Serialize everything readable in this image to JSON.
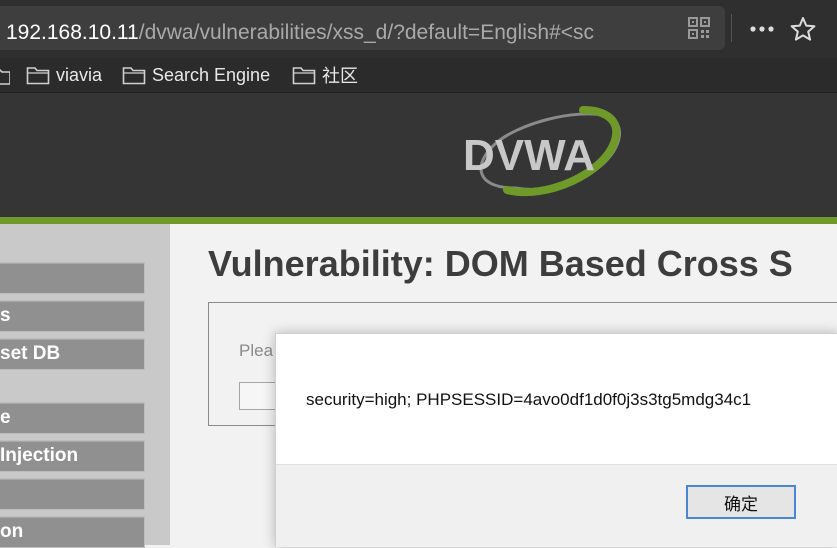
{
  "browser": {
    "url_host": "192.168.10.11",
    "url_path": "/dvwa/vulnerabilities/xss_d/?default=English#<sc",
    "bookmarks": [
      {
        "label": "viavia"
      },
      {
        "label": "Search Engine"
      },
      {
        "label": "社区"
      }
    ]
  },
  "header": {
    "logo_text": "DVWA"
  },
  "sidebar": {
    "items": [
      {
        "label": ""
      },
      {
        "label": "s"
      },
      {
        "label": "set DB"
      },
      {
        "label": "e"
      },
      {
        "label": "Injection"
      },
      {
        "label": ""
      },
      {
        "label": "on"
      }
    ]
  },
  "main": {
    "title": "Vulnerability: DOM Based Cross S",
    "form_prompt": "Plea"
  },
  "alert": {
    "message": "security=high; PHPSESSID=4avo0df1d0f0j3s3tg5mdg34c1",
    "ok_label": "确定"
  },
  "colors": {
    "header_bg": "#353535",
    "accent_green": "#6f9a2a",
    "dialog_button_border": "#4a86d6"
  }
}
